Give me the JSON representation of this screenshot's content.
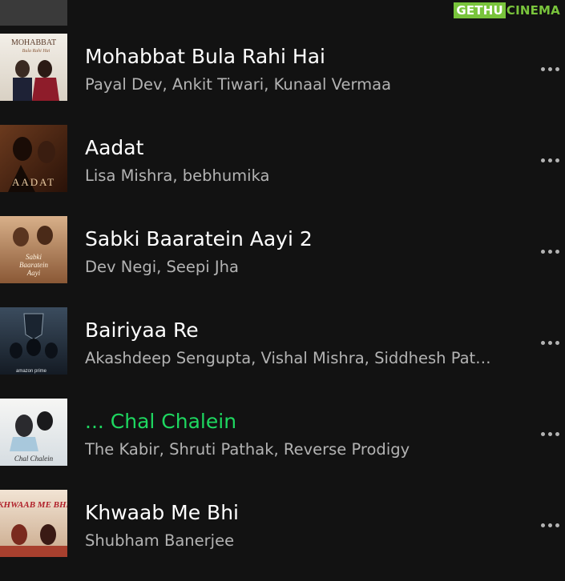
{
  "watermark": {
    "left": "GETHU",
    "right": "CINEMA"
  },
  "tracks": [
    {
      "title": "",
      "artists": "",
      "cover_text": "",
      "playing": false
    },
    {
      "title": "Mohabbat Bula Rahi Hai",
      "artists": "Payal Dev, Ankit Tiwari, Kunaal Vermaa",
      "cover_text": "MOHABBAT",
      "playing": false
    },
    {
      "title": "Aadat",
      "artists": "Lisa Mishra, bebhumika",
      "cover_text": "AADAT",
      "playing": false
    },
    {
      "title": "Sabki Baaratein Aayi 2",
      "artists": "Dev Negi, Seepi Jha",
      "cover_text": "Sabki Baaratein Aayi",
      "playing": false
    },
    {
      "title": "Bairiyaa Re",
      "artists": "Akashdeep Sengupta, Vishal Mishra, Siddhesh Pat…",
      "cover_text": "amazon prime",
      "playing": false
    },
    {
      "title": "... Chal Chalein",
      "artists": "The Kabir, Shruti Pathak, Reverse Prodigy",
      "cover_text": "Chal Chalein",
      "playing": true
    },
    {
      "title": "Khwaab Me Bhi",
      "artists": "Shubham Banerjee",
      "cover_text": "KHWAAB ME BHI",
      "playing": false
    }
  ],
  "colors": {
    "background": "#121212",
    "title": "#ffffff",
    "subtitle": "#b3b3b3",
    "accent_playing": "#1ed760"
  },
  "icons": {
    "more_options": "more-horizontal-icon"
  }
}
